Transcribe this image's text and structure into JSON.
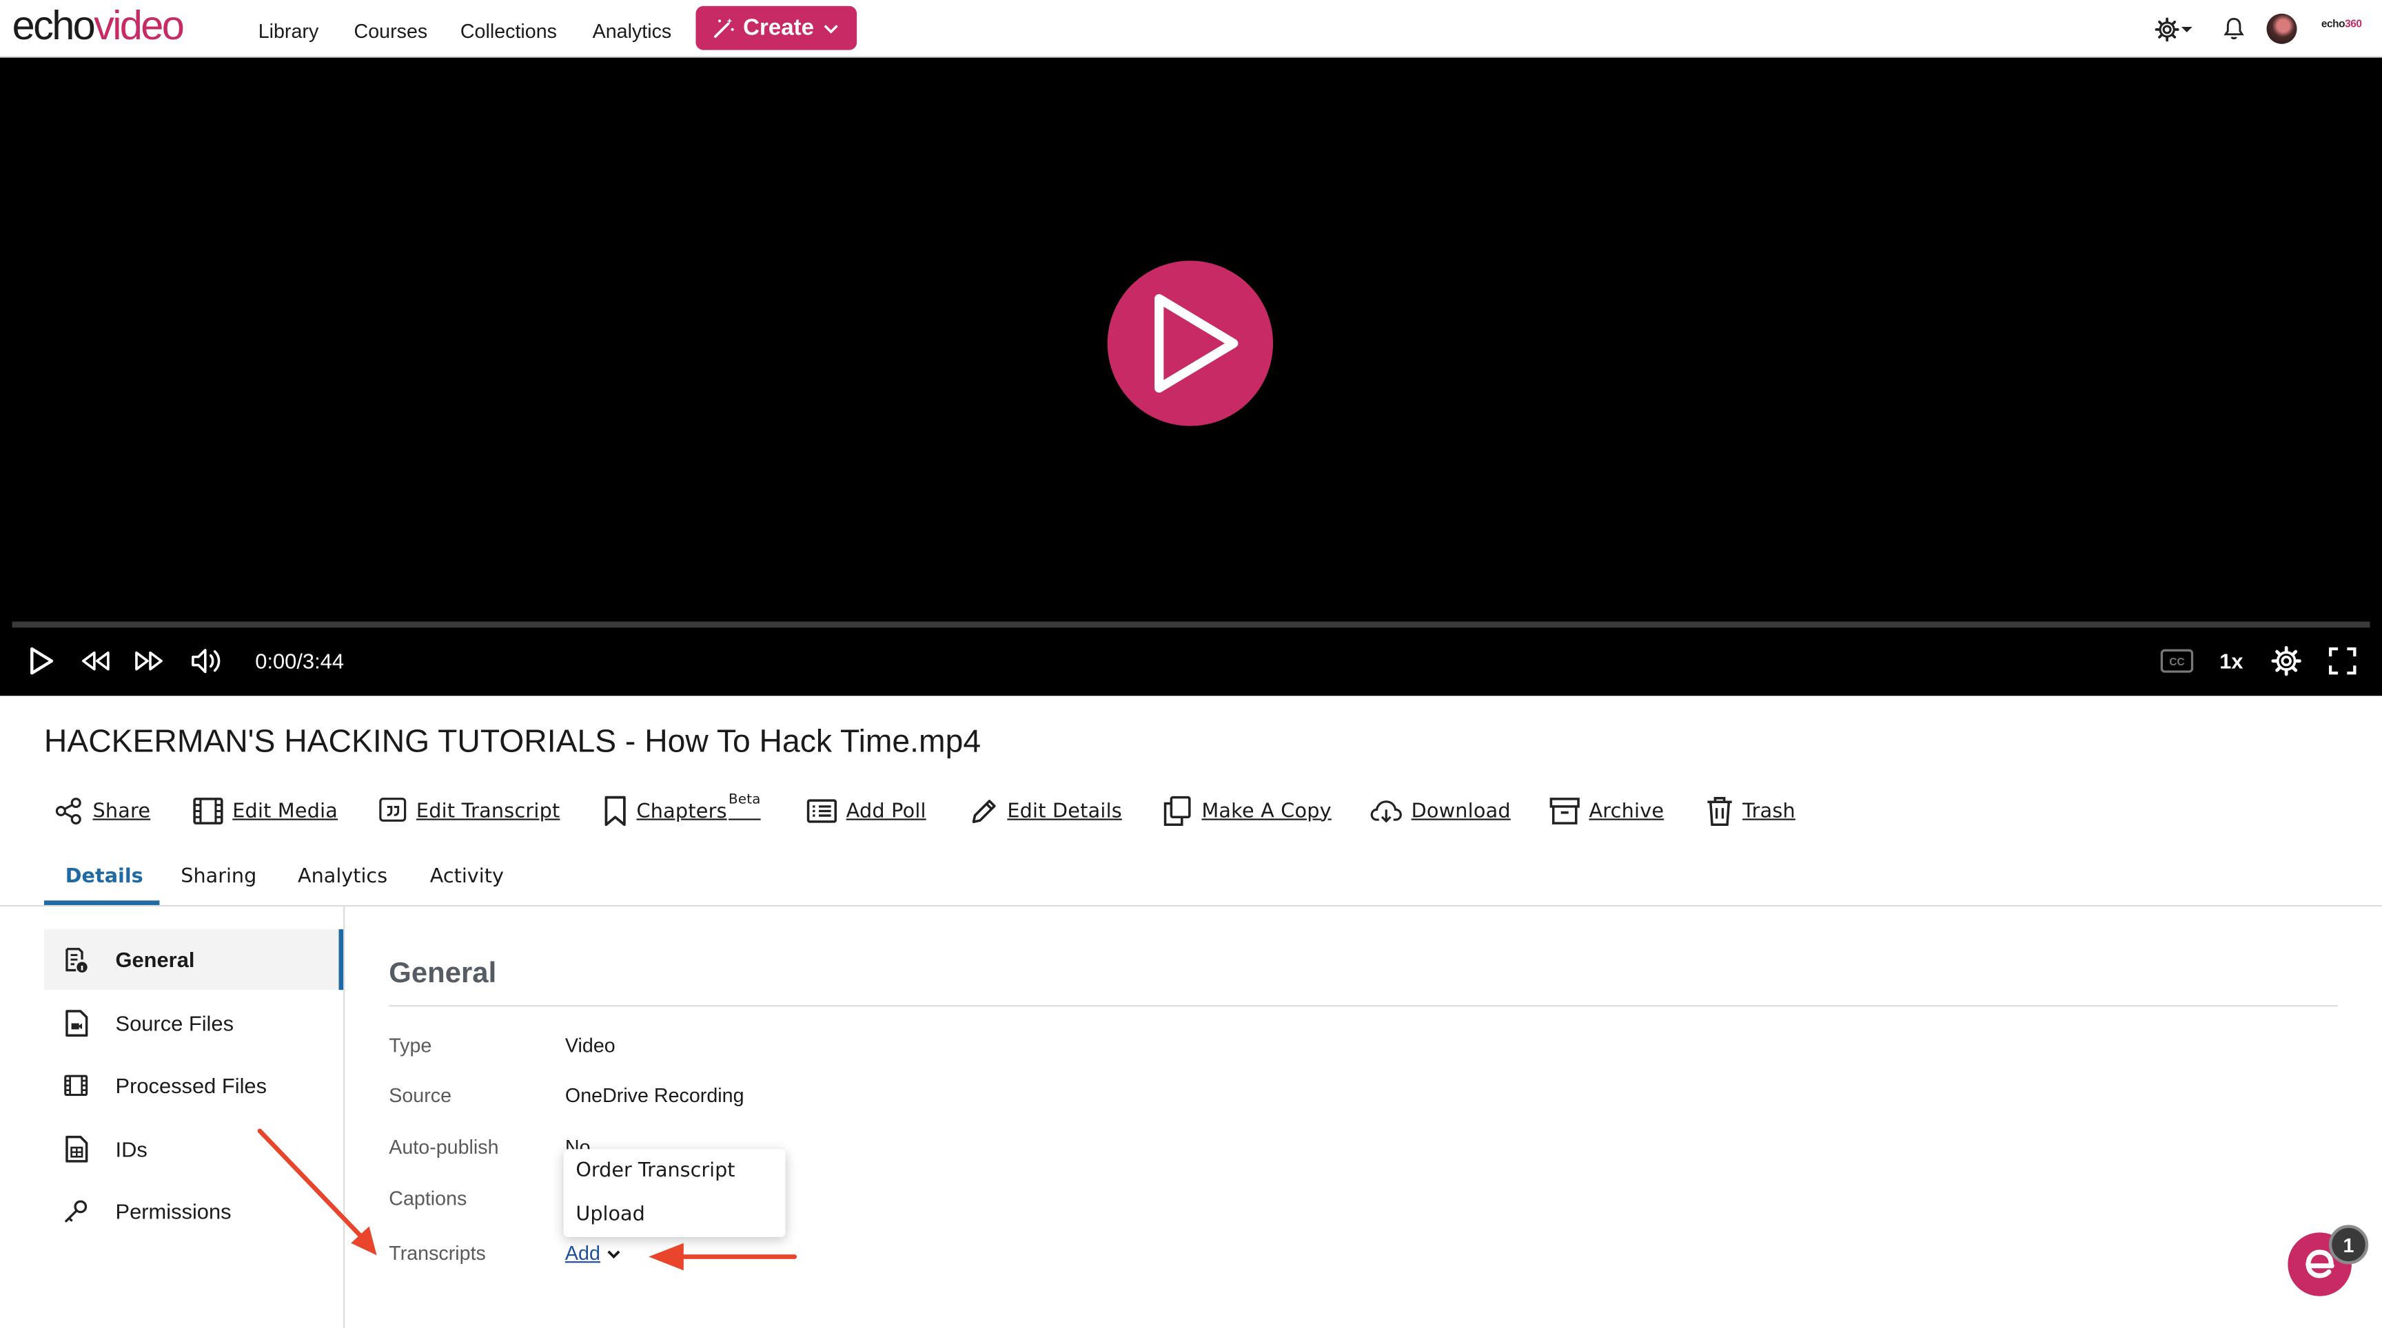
{
  "brand": {
    "part1": "echo",
    "part2": "video"
  },
  "nav": {
    "links": [
      "Library",
      "Courses",
      "Collections",
      "Analytics"
    ],
    "create_label": "Create"
  },
  "topbar": {
    "brand_small_a": "echo",
    "brand_small_b": "360"
  },
  "player": {
    "time": "0:00/3:44",
    "speed": "1x",
    "progress": 0
  },
  "media": {
    "title": "HACKERMAN'S HACKING TUTORIALS - How To Hack Time.mp4"
  },
  "actions": {
    "share": "Share",
    "edit_media": "Edit Media",
    "edit_transcript": "Edit Transcript",
    "chapters": "Chapters",
    "chapters_badge": "Beta",
    "add_poll": "Add Poll",
    "edit_details": "Edit Details",
    "make_copy": "Make A Copy",
    "download": "Download",
    "archive": "Archive",
    "trash": "Trash"
  },
  "tabs": {
    "details": "Details",
    "sharing": "Sharing",
    "analytics": "Analytics",
    "activity": "Activity"
  },
  "sidebar": {
    "items": [
      {
        "label": "General"
      },
      {
        "label": "Source Files"
      },
      {
        "label": "Processed Files"
      },
      {
        "label": "IDs"
      },
      {
        "label": "Permissions"
      }
    ]
  },
  "general": {
    "title": "General",
    "fields": [
      {
        "label": "Type",
        "value": "Video"
      },
      {
        "label": "Source",
        "value": "OneDrive Recording"
      },
      {
        "label": "Auto-publish",
        "value": "No"
      },
      {
        "label": "Captions",
        "value": ""
      },
      {
        "label": "Transcripts",
        "value": ""
      }
    ],
    "add_label": "Add"
  },
  "dropdown": {
    "items": [
      "Order Transcript",
      "Upload"
    ]
  },
  "chat": {
    "badge": "1"
  },
  "colors": {
    "brand": "#c72a65",
    "accent_blue": "#1f6aa5",
    "annotation_arrow": "#e8452c"
  }
}
